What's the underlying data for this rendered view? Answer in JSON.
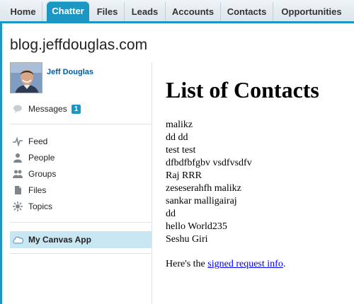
{
  "tabs": [
    {
      "label": "Home",
      "active": false
    },
    {
      "label": "Chatter",
      "active": true
    },
    {
      "label": "Files",
      "active": false
    },
    {
      "label": "Leads",
      "active": false
    },
    {
      "label": "Accounts",
      "active": false
    },
    {
      "label": "Contacts",
      "active": false
    },
    {
      "label": "Opportunities",
      "active": false
    }
  ],
  "site_title": "blog.jeffdouglas.com",
  "user": {
    "name": "Jeff Douglas"
  },
  "messages": {
    "label": "Messages",
    "count": "1"
  },
  "nav": [
    {
      "label": "Feed",
      "icon": "feed-icon"
    },
    {
      "label": "People",
      "icon": "people-icon"
    },
    {
      "label": "Groups",
      "icon": "groups-icon"
    },
    {
      "label": "Files",
      "icon": "files-icon"
    },
    {
      "label": "Topics",
      "icon": "topics-icon"
    }
  ],
  "canvas_app": {
    "label": "My Canvas App",
    "icon": "canvas-app-icon"
  },
  "canvas": {
    "heading": "List of Contacts",
    "contacts": [
      "malikz",
      "dd dd",
      "test test",
      "dfbdfbfgbv vsdfvsdfv",
      "Raj RRR",
      "zeseserahfh malikz",
      "sankar malligairaj",
      "dd",
      "hello World235",
      "Seshu Giri"
    ],
    "request_prefix": "Here's the ",
    "request_link": "signed request info",
    "request_suffix": "."
  },
  "colors": {
    "accent": "#1c97c4",
    "link": "#015ba7",
    "highlight": "#c9e6f3"
  }
}
